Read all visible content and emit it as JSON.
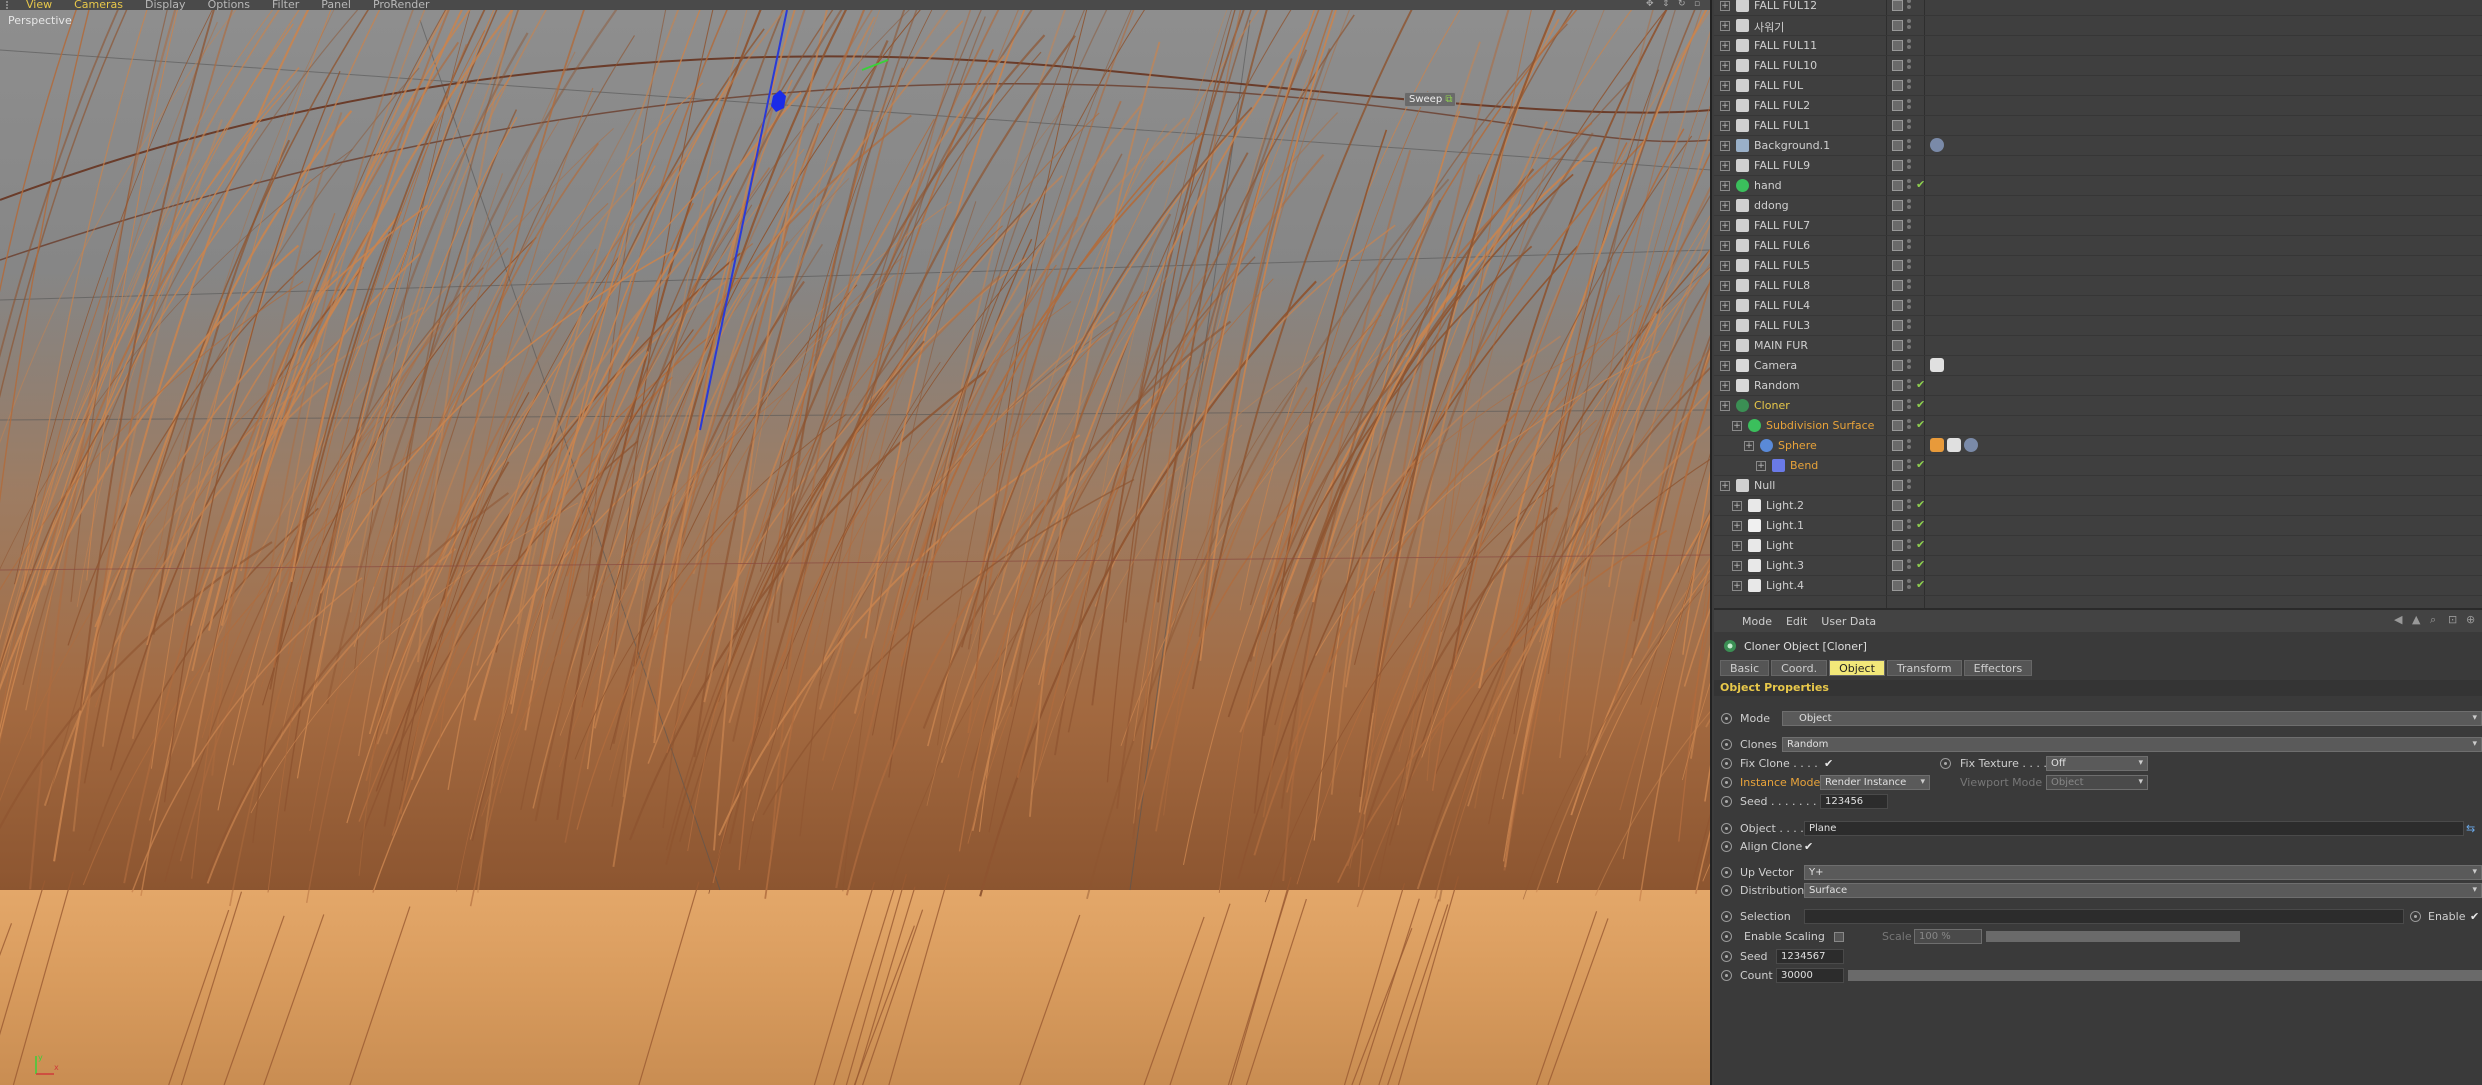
{
  "viewport": {
    "menu": [
      "View",
      "Cameras",
      "Display",
      "Options",
      "Filter",
      "Panel",
      "ProRender"
    ],
    "label": "Perspective",
    "sweep_tag": "Sweep",
    "axes": {
      "y": "y",
      "x": "x"
    }
  },
  "object_manager": {
    "objects": [
      {
        "name": "FALL FUL12",
        "icon": "null-icon",
        "style": "normal",
        "check": false,
        "tags": []
      },
      {
        "name": "사워기",
        "icon": "null-icon",
        "style": "normal",
        "check": false,
        "tags": []
      },
      {
        "name": "FALL FUL11",
        "icon": "null-icon",
        "style": "normal",
        "check": false,
        "tags": []
      },
      {
        "name": "FALL FUL10",
        "icon": "null-icon",
        "style": "normal",
        "check": false,
        "tags": []
      },
      {
        "name": "FALL FUL",
        "icon": "null-icon",
        "style": "normal",
        "check": false,
        "tags": []
      },
      {
        "name": "FALL FUL2",
        "icon": "null-icon",
        "style": "normal",
        "check": false,
        "tags": []
      },
      {
        "name": "FALL FUL1",
        "icon": "null-icon",
        "style": "normal",
        "check": false,
        "tags": []
      },
      {
        "name": "Background.1",
        "icon": "background-icon",
        "style": "normal",
        "check": false,
        "tags": [
          "material"
        ]
      },
      {
        "name": "FALL FUL9",
        "icon": "null-icon",
        "style": "normal",
        "check": false,
        "tags": []
      },
      {
        "name": "hand",
        "icon": "subdivision-icon",
        "style": "normal",
        "check": true,
        "tags": []
      },
      {
        "name": "ddong",
        "icon": "null-icon",
        "style": "normal",
        "check": false,
        "tags": []
      },
      {
        "name": "FALL FUL7",
        "icon": "null-icon",
        "style": "normal",
        "check": false,
        "tags": []
      },
      {
        "name": "FALL FUL6",
        "icon": "null-icon",
        "style": "normal",
        "check": false,
        "tags": []
      },
      {
        "name": "FALL FUL5",
        "icon": "null-icon",
        "style": "normal",
        "check": false,
        "tags": []
      },
      {
        "name": "FALL FUL8",
        "icon": "null-icon",
        "style": "normal",
        "check": false,
        "tags": []
      },
      {
        "name": "FALL FUL4",
        "icon": "null-icon",
        "style": "normal",
        "check": false,
        "tags": []
      },
      {
        "name": "FALL FUL3",
        "icon": "null-icon",
        "style": "normal",
        "check": false,
        "tags": []
      },
      {
        "name": "MAIN FUR",
        "icon": "null-icon",
        "style": "normal",
        "check": false,
        "tags": []
      },
      {
        "name": "Camera",
        "icon": "camera-icon",
        "style": "normal",
        "check": false,
        "tags": [
          "protection"
        ]
      },
      {
        "name": "Random",
        "icon": "random-icon",
        "style": "normal",
        "check": true,
        "tags": []
      },
      {
        "name": "Cloner",
        "icon": "cloner-icon",
        "style": "hl",
        "check": true,
        "tags": []
      },
      {
        "name": "Subdivision Surface",
        "icon": "subdivision-icon",
        "style": "sel",
        "check": true,
        "tags": []
      },
      {
        "name": "Sphere",
        "icon": "sphere-icon",
        "style": "sel",
        "check": false,
        "tags": [
          "phong",
          "checker",
          "material"
        ]
      },
      {
        "name": "Bend",
        "icon": "bend-icon",
        "style": "sel",
        "check": true,
        "tags": []
      },
      {
        "name": "Null",
        "icon": "null-icon",
        "style": "normal",
        "check": false,
        "tags": []
      },
      {
        "name": "Light.2",
        "icon": "light-icon",
        "style": "normal",
        "check": true,
        "tags": []
      },
      {
        "name": "Light.1",
        "icon": "area-light-icon",
        "style": "normal",
        "check": true,
        "tags": []
      },
      {
        "name": "Light",
        "icon": "light-icon",
        "style": "normal",
        "check": true,
        "tags": []
      },
      {
        "name": "Light.3",
        "icon": "light-icon",
        "style": "normal",
        "check": true,
        "tags": []
      },
      {
        "name": "Light.4",
        "icon": "light-icon",
        "style": "normal",
        "check": true,
        "tags": []
      }
    ]
  },
  "attributes": {
    "menu": [
      "Mode",
      "Edit",
      "User Data"
    ],
    "title": "Cloner Object [Cloner]",
    "tabs": [
      "Basic",
      "Coord.",
      "Object",
      "Transform",
      "Effectors"
    ],
    "active_tab": "Object",
    "section": "Object Properties",
    "mode_label": "Mode",
    "mode_value": "Object",
    "clones_label": "Clones",
    "clones_value": "Random",
    "fix_clone_label": "Fix Clone . . . .",
    "fix_texture_label": "Fix Texture . . . .",
    "fix_texture_value": "Off",
    "instance_mode_label": "Instance Mode",
    "instance_mode_value": "Render Instance",
    "viewport_mode_label": "Viewport Mode",
    "viewport_mode_value": "Object",
    "seed_label": "Seed . . . . . . .",
    "seed_value": "123456",
    "object_label": "Object . . . .",
    "object_value": "Plane",
    "align_clone_label": "Align Clone",
    "up_vector_label": "Up Vector",
    "up_vector_value": "Y+",
    "distribution_label": "Distribution",
    "distribution_value": "Surface",
    "selection_label": "Selection",
    "enable_label": "Enable",
    "enable_scaling_label": "Enable Scaling",
    "scale_label": "Scale",
    "scale_value": "100 %",
    "seed2_label": "Seed",
    "seed2_value": "1234567",
    "count_label": "Count",
    "count_value": "30000"
  }
}
